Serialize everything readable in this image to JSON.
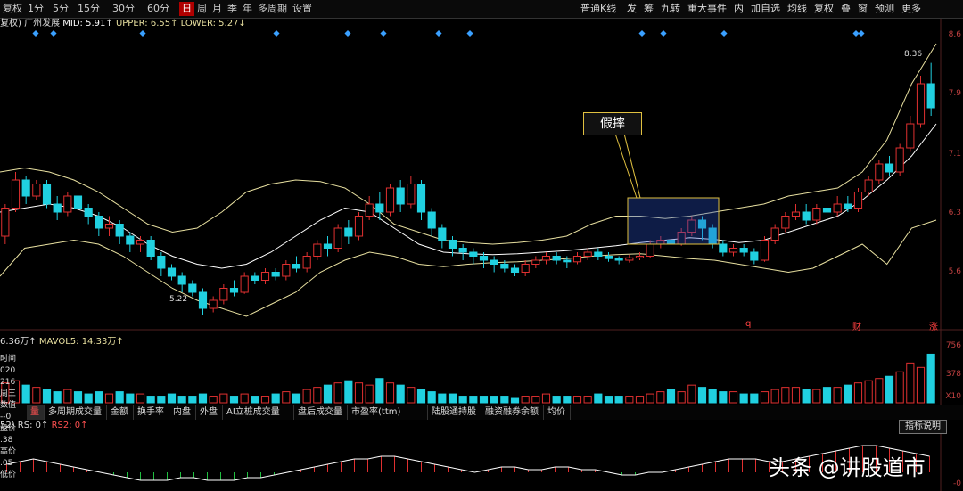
{
  "toolbar": {
    "left_items": [
      "复权",
      "1分",
      "5分",
      "15分",
      "30分",
      "60分",
      "日",
      "周",
      "月",
      "季",
      "年",
      "多周期",
      "设置"
    ],
    "selected": "日",
    "right_items": [
      "普通K线",
      "发",
      "筹",
      "九转",
      "重大事件",
      "内",
      "加自选",
      "均线",
      "复权",
      "叠",
      "窗",
      "预测",
      "更多"
    ]
  },
  "indicator": {
    "period_label": "复权)",
    "name": "广州发展",
    "mid_label": "MID: 5.91↑",
    "upper_label": "UPPER: 6.55↑",
    "lower_label": "LOWER: 5.27↓"
  },
  "price_axis": [
    "8.6",
    "7.9",
    "7.1",
    "6.3",
    "5.6"
  ],
  "volume_axis": [
    "756",
    "378",
    "X10"
  ],
  "rs_axis": [
    "-0"
  ],
  "price_labels": {
    "high": "8.36",
    "low": "5.22"
  },
  "event_markers": [
    "q",
    "财",
    "涨"
  ],
  "annotation": {
    "text": "假摔"
  },
  "volume_indicator": {
    "vol_label": "6.36万↑",
    "mavol_label": "MAVOL5: 14.33万↑"
  },
  "tabs": [
    "量",
    "多周期成交量",
    "金额",
    "换手率",
    "内盘",
    "外盘",
    "AI立桩成交量",
    "盘后成交量",
    "市盈率(ttm)",
    "陆股通持股",
    "融资融券余额",
    "均价"
  ],
  "rs_indicator": {
    "label1": "52) RS: 0↑",
    "label2": "RS2: 0↑"
  },
  "explain_button": "指标说明",
  "left_panel": [
    "时间",
    "020",
    "216",
    "周三",
    "数值",
    "--0",
    "盘价",
    ".38",
    "高价",
    ".05",
    "低价"
  ],
  "watermark": "头条 @讲股道市",
  "colors": {
    "up": "#e03030",
    "down": "#20d0e0",
    "boll": "#e8e0a0",
    "rs_up": "#e03030",
    "rs_down": "#20c040",
    "marker": "#3aa0ff"
  },
  "chart_data": {
    "type": "candlestick",
    "boll_mid": [
      6.5,
      6.55,
      6.6,
      6.55,
      6.45,
      6.3,
      6.1,
      5.95,
      5.85,
      5.8,
      5.85,
      6.0,
      6.2,
      6.4,
      6.55,
      6.5,
      6.3,
      6.1,
      6.0,
      5.98,
      5.97,
      5.98,
      6.0,
      6.02,
      6.05,
      6.08,
      6.12,
      6.15,
      6.18,
      6.16,
      6.12,
      6.15,
      6.25,
      6.35,
      6.45,
      6.65,
      6.9,
      7.2,
      7.6
    ],
    "boll_upper": [
      7.0,
      7.05,
      7.0,
      6.9,
      6.75,
      6.55,
      6.35,
      6.25,
      6.3,
      6.5,
      6.75,
      6.85,
      6.9,
      6.88,
      6.8,
      6.6,
      6.35,
      6.25,
      6.15,
      6.12,
      6.1,
      6.12,
      6.15,
      6.2,
      6.35,
      6.45,
      6.45,
      6.42,
      6.45,
      6.5,
      6.55,
      6.6,
      6.7,
      6.75,
      6.8,
      7.0,
      7.4,
      8.1,
      8.6
    ],
    "boll_lower": [
      5.7,
      6.05,
      6.1,
      6.15,
      6.1,
      5.95,
      5.75,
      5.55,
      5.4,
      5.3,
      5.2,
      5.35,
      5.5,
      5.75,
      5.9,
      6.0,
      5.95,
      5.85,
      5.82,
      5.85,
      5.87,
      5.88,
      5.9,
      5.92,
      5.95,
      5.97,
      5.98,
      5.95,
      5.92,
      5.9,
      5.85,
      5.8,
      5.75,
      5.8,
      5.95,
      6.1,
      5.85,
      6.3,
      6.4
    ],
    "candles": [
      [
        6.2,
        6.55,
        6.1,
        6.6
      ],
      [
        6.55,
        6.9,
        6.5,
        7.0
      ],
      [
        6.9,
        6.7,
        6.6,
        6.95
      ],
      [
        6.7,
        6.85,
        6.65,
        6.9
      ],
      [
        6.85,
        6.6,
        6.55,
        6.9
      ],
      [
        6.6,
        6.5,
        6.4,
        6.7
      ],
      [
        6.5,
        6.7,
        6.45,
        6.75
      ],
      [
        6.7,
        6.55,
        6.5,
        6.75
      ],
      [
        6.55,
        6.45,
        6.35,
        6.6
      ],
      [
        6.45,
        6.3,
        6.2,
        6.5
      ],
      [
        6.3,
        6.35,
        6.2,
        6.45
      ],
      [
        6.35,
        6.2,
        6.1,
        6.4
      ],
      [
        6.2,
        6.1,
        6.0,
        6.25
      ],
      [
        6.1,
        6.15,
        6.0,
        6.2
      ],
      [
        6.15,
        5.95,
        5.9,
        6.2
      ],
      [
        5.95,
        5.8,
        5.7,
        6.0
      ],
      [
        5.8,
        5.7,
        5.65,
        5.85
      ],
      [
        5.7,
        5.6,
        5.5,
        5.75
      ],
      [
        5.6,
        5.5,
        5.45,
        5.65
      ],
      [
        5.5,
        5.3,
        5.22,
        5.55
      ],
      [
        5.3,
        5.4,
        5.25,
        5.45
      ],
      [
        5.4,
        5.55,
        5.35,
        5.6
      ],
      [
        5.55,
        5.5,
        5.45,
        5.65
      ],
      [
        5.5,
        5.7,
        5.48,
        5.75
      ],
      [
        5.7,
        5.65,
        5.6,
        5.75
      ],
      [
        5.65,
        5.75,
        5.6,
        5.8
      ],
      [
        5.75,
        5.7,
        5.65,
        5.8
      ],
      [
        5.7,
        5.85,
        5.65,
        5.9
      ],
      [
        5.85,
        5.8,
        5.75,
        5.95
      ],
      [
        5.8,
        5.95,
        5.75,
        6.0
      ],
      [
        5.95,
        6.1,
        5.9,
        6.15
      ],
      [
        6.1,
        6.05,
        5.95,
        6.2
      ],
      [
        6.05,
        6.3,
        6.0,
        6.35
      ],
      [
        6.3,
        6.2,
        6.1,
        6.4
      ],
      [
        6.2,
        6.45,
        6.15,
        6.5
      ],
      [
        6.45,
        6.6,
        6.4,
        6.7
      ],
      [
        6.6,
        6.5,
        6.4,
        6.75
      ],
      [
        6.5,
        6.8,
        6.45,
        6.85
      ],
      [
        6.8,
        6.6,
        6.5,
        6.9
      ],
      [
        6.6,
        6.85,
        6.55,
        6.95
      ],
      [
        6.85,
        6.5,
        6.4,
        6.9
      ],
      [
        6.5,
        6.3,
        6.2,
        6.55
      ],
      [
        6.3,
        6.15,
        6.05,
        6.35
      ],
      [
        6.15,
        6.05,
        5.95,
        6.2
      ],
      [
        6.05,
        6.0,
        5.9,
        6.1
      ],
      [
        6.0,
        5.95,
        5.85,
        6.05
      ],
      [
        5.95,
        5.9,
        5.8,
        6.0
      ],
      [
        5.9,
        5.85,
        5.75,
        5.95
      ],
      [
        5.85,
        5.8,
        5.75,
        5.9
      ],
      [
        5.8,
        5.75,
        5.7,
        5.85
      ],
      [
        5.75,
        5.85,
        5.7,
        5.9
      ],
      [
        5.85,
        5.9,
        5.8,
        5.95
      ],
      [
        5.9,
        5.95,
        5.85,
        6.0
      ],
      [
        5.95,
        5.9,
        5.85,
        6.0
      ],
      [
        5.9,
        5.88,
        5.8,
        5.95
      ],
      [
        5.88,
        5.95,
        5.85,
        6.0
      ],
      [
        5.95,
        6.0,
        5.9,
        6.05
      ],
      [
        6.0,
        5.95,
        5.9,
        6.05
      ],
      [
        5.95,
        5.92,
        5.88,
        6.0
      ],
      [
        5.92,
        5.9,
        5.85,
        5.95
      ],
      [
        5.9,
        5.93,
        5.87,
        5.97
      ],
      [
        5.93,
        5.95,
        5.9,
        6.0
      ],
      [
        5.95,
        6.1,
        5.93,
        6.15
      ],
      [
        6.1,
        6.15,
        6.05,
        6.2
      ],
      [
        6.15,
        6.1,
        6.05,
        6.2
      ],
      [
        6.1,
        6.25,
        6.08,
        6.3
      ],
      [
        6.25,
        6.4,
        6.2,
        6.45
      ],
      [
        6.4,
        6.3,
        6.15,
        6.45
      ],
      [
        6.3,
        6.1,
        6.05,
        6.35
      ],
      [
        6.1,
        6.0,
        5.95,
        6.15
      ],
      [
        6.0,
        6.05,
        5.95,
        6.1
      ],
      [
        6.05,
        6.0,
        5.95,
        6.1
      ],
      [
        6.0,
        5.9,
        5.85,
        6.05
      ],
      [
        5.9,
        6.15,
        5.88,
        6.2
      ],
      [
        6.15,
        6.3,
        6.1,
        6.35
      ],
      [
        6.3,
        6.45,
        6.25,
        6.5
      ],
      [
        6.45,
        6.5,
        6.4,
        6.6
      ],
      [
        6.5,
        6.4,
        6.35,
        6.6
      ],
      [
        6.4,
        6.55,
        6.35,
        6.6
      ],
      [
        6.55,
        6.5,
        6.45,
        6.65
      ],
      [
        6.5,
        6.6,
        6.45,
        6.7
      ],
      [
        6.6,
        6.55,
        6.5,
        6.7
      ],
      [
        6.55,
        6.75,
        6.5,
        6.8
      ],
      [
        6.75,
        6.9,
        6.7,
        6.95
      ],
      [
        6.9,
        7.1,
        6.85,
        7.15
      ],
      [
        7.1,
        7.0,
        6.95,
        7.2
      ],
      [
        7.0,
        7.3,
        6.95,
        7.35
      ],
      [
        7.3,
        7.6,
        7.25,
        7.7
      ],
      [
        7.6,
        8.1,
        7.55,
        8.2
      ],
      [
        8.1,
        7.8,
        7.7,
        8.36
      ]
    ],
    "volume": [
      9,
      10,
      8,
      7,
      6,
      5,
      6,
      5,
      4,
      5,
      4,
      5,
      4,
      4,
      3,
      3,
      4,
      3,
      3,
      4,
      3,
      4,
      3,
      4,
      3,
      3,
      4,
      5,
      4,
      6,
      7,
      8,
      9,
      10,
      9,
      8,
      11,
      9,
      8,
      7,
      6,
      5,
      4,
      4,
      3,
      3,
      3,
      3,
      3,
      2,
      3,
      3,
      4,
      3,
      3,
      3,
      3,
      4,
      3,
      3,
      3,
      3,
      4,
      5,
      6,
      5,
      8,
      7,
      6,
      5,
      5,
      4,
      4,
      5,
      6,
      7,
      7,
      6,
      6,
      7,
      7,
      8,
      9,
      10,
      11,
      12,
      14,
      18,
      16,
      22
    ],
    "volume_ylim": [
      0,
      25
    ],
    "rs": [
      3,
      4,
      5,
      4,
      3,
      2,
      1,
      0,
      -1,
      -2,
      -3,
      -3,
      -3,
      -2,
      -2,
      -3,
      -3,
      -3,
      -2,
      -2,
      -1,
      0,
      1,
      2,
      3,
      4,
      5,
      5,
      6,
      6,
      5,
      4,
      3,
      2,
      1,
      0,
      1,
      2,
      2,
      1,
      1,
      2,
      2,
      1,
      1,
      0,
      -1,
      -1,
      0,
      0,
      1,
      2,
      3,
      4,
      5,
      5,
      5,
      4,
      4,
      5,
      6,
      7,
      8,
      9,
      10,
      10,
      9,
      8,
      7,
      6
    ],
    "ylim": [
      5.2,
      8.7
    ]
  }
}
